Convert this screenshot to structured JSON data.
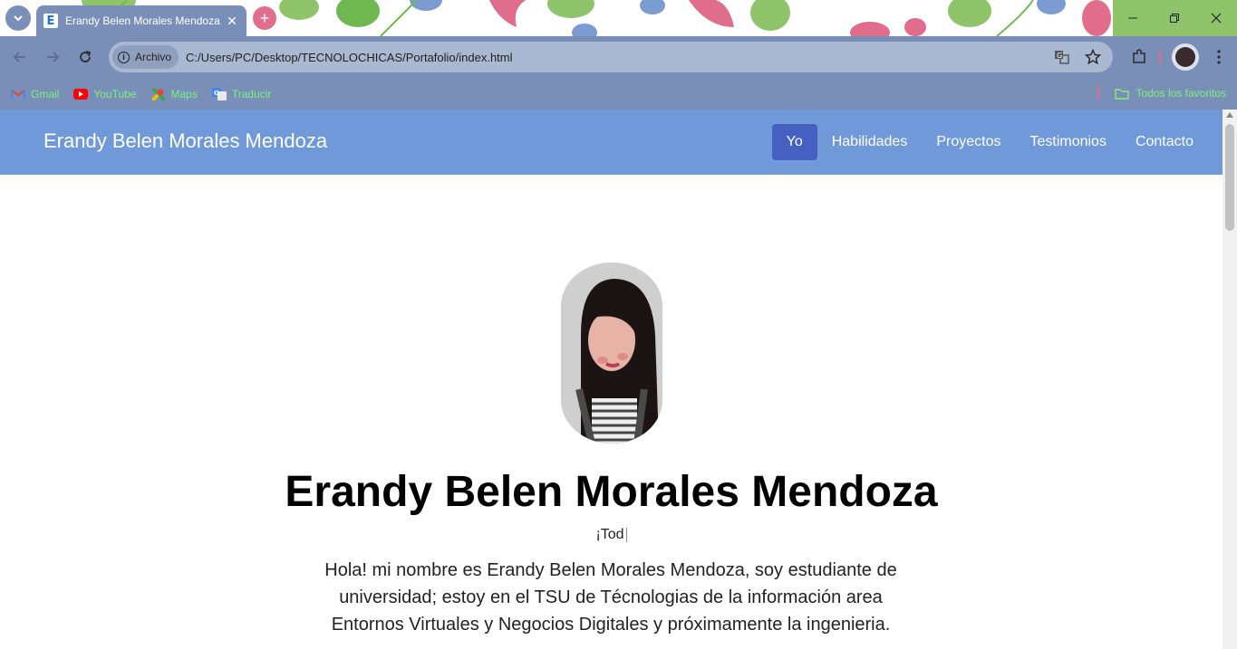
{
  "browser": {
    "tab": {
      "title": "Erandy Belen Morales Mendoza",
      "favicon_letter": "E"
    },
    "new_tab_icon": "+",
    "close_tab_icon": "✕",
    "address_chip": "Archivo",
    "url": "C:/Users/PC/Desktop/TECNOLOCHICAS/Portafolio/index.html",
    "bookmarks": [
      {
        "label": "Gmail",
        "icon": "gmail-icon"
      },
      {
        "label": "YouTube",
        "icon": "youtube-icon"
      },
      {
        "label": "Maps",
        "icon": "maps-icon"
      },
      {
        "label": "Traducir",
        "icon": "translate-icon"
      }
    ],
    "all_bookmarks": "Todos los favoritos",
    "colors": {
      "frame": "#7a8fb8",
      "bookmark_text": "#7cf07c",
      "accent_pink": "#e06d8c"
    }
  },
  "site": {
    "brand": "Erandy Belen Morales Mendoza",
    "nav": [
      {
        "label": "Yo",
        "active": true
      },
      {
        "label": "Habilidades",
        "active": false
      },
      {
        "label": "Proyectos",
        "active": false
      },
      {
        "label": "Testimonios",
        "active": false
      },
      {
        "label": "Contacto",
        "active": false
      }
    ],
    "hero": {
      "title": "Erandy Belen Morales Mendoza",
      "typed_text": "¡Tod",
      "bio": "Hola! mi nombre es Erandy Belen Morales Mendoza, soy estudiante de universidad; estoy en el TSU de Técnologias de la información area Entornos Virtuales y Negocios Digitales y próximamente la ingenieria."
    },
    "colors": {
      "navbar": "#6f99d8",
      "active_nav": "#4560c0"
    }
  }
}
